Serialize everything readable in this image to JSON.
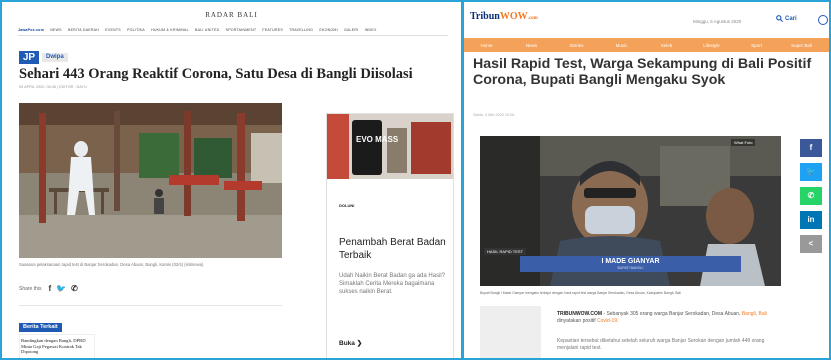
{
  "left": {
    "site_logo": "RADAR BALI",
    "nav_brand": "JawaPos.com",
    "nav_items": [
      "NEWS",
      "BERITA DAERAH",
      "EVENTS",
      "POLITIKA",
      "HUKUM & KRIMINAL",
      "BALI UNITED",
      "SPORTAINMENT",
      "FEATURES",
      "TRAVELLING",
      "EKONOMI",
      "GALERI",
      "INDEX"
    ],
    "badge_jp": "JP",
    "badge_category": "Dwipa",
    "headline": "Sehari 443 Orang Reaktif Corona, Satu Desa di Bangli Diisolasi",
    "meta": "05 APRIL 2020, 06:45 | EDITOR : DAYU",
    "caption": "Suasana pelaksanaan rapid test di Banjar Serokadan, Desa Abuan, Bangli, Kamis (02/4) (istimewa)",
    "share_label": "Share this",
    "related_label": "Berita Terkait",
    "related_title": "Bandingkan dengan Bangli, DPRD Minta Gaji Pegawai Kontrak Tak Dipotong",
    "ad": {
      "logo_text": "DOLUNI",
      "image_text": "EVO MASS",
      "title": "Penambah Berat Badan Terbaik",
      "description": "Udah Naikin Berat Badan ga ada Hasil? Simaklah Cerita Mereka bagaimana sukses naikin Berat.",
      "cta": "Buka ❯"
    }
  },
  "right": {
    "logo_main": "Tribun",
    "logo_accent": "WOW",
    "logo_suffix": ".com",
    "date": "Minggu, 5 Agustus 2020",
    "search_label": "Cari",
    "nav_items": [
      "Home",
      "News",
      "Stories",
      "Music",
      "Seleb",
      "Lifestyle",
      "Sport",
      "Super Ball"
    ],
    "headline": "Hasil Rapid Test, Warga Sekampung di Bali Positif Corona, Bupati Bangli Mengaku Syok",
    "meta": "Sabtu, 4 Mei 2020 10:06",
    "video": {
      "what_label": "What Foto",
      "hasil_label": "HASIL RAPID TEST",
      "lower_third_name": "I MADE GIANYAR",
      "lower_third_title": "BUPATI BANGLI"
    },
    "caption": "Bupati Bangli I Made Gianyar mengaku terkejut dengan hasil rapid test warga Banjar Serokadan, Desa Abuan, Kabupaten Bangli, Bali",
    "body_source": "TRIBUNWOW.COM",
    "body_text_1": " - Sebanyak 305 orang warga Banjar Serokadan, Desa Abuan, ",
    "body_highlight_1": "Bangli, Bali",
    "body_text_2": " dinyatakan positif ",
    "body_highlight_2": "Covid-19",
    "body_text_3": ".",
    "body_para2": "Kepastian tersebut diketahui setelah seluruh warga Banjar Serokan dengan jumlah 448 orang menjalani rapid test.",
    "social_buttons": [
      {
        "label": "f",
        "color": "#3b5998"
      },
      {
        "label": "🐦",
        "color": "#1da1f2"
      },
      {
        "label": "✆",
        "color": "#25d366"
      },
      {
        "label": "in",
        "color": "#0077b5"
      },
      {
        "label": "<",
        "color": "#999999"
      }
    ]
  }
}
